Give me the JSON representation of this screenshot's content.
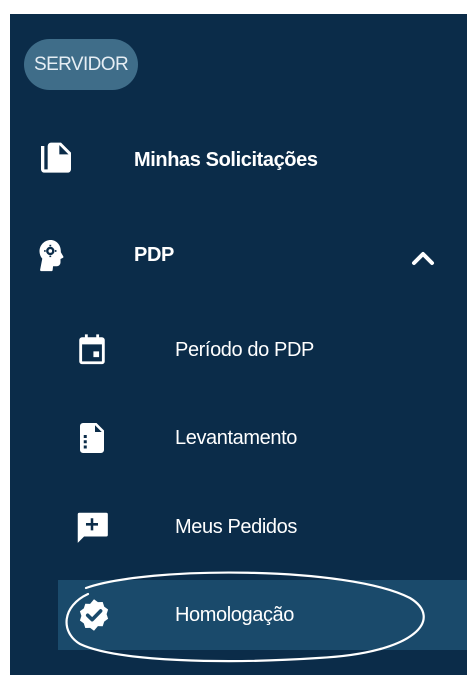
{
  "sidebar": {
    "role_badge": "SERVIDOR",
    "items": [
      {
        "label": "Minhas Solicitações",
        "icon": "file-copy-icon"
      },
      {
        "label": "PDP",
        "icon": "head-gear-icon",
        "expanded": true,
        "chevron_icon": "chevron-up-icon"
      }
    ],
    "subitems": [
      {
        "label": "Período do PDP",
        "icon": "calendar-icon"
      },
      {
        "label": "Levantamento",
        "icon": "document-list-icon"
      },
      {
        "label": "Meus Pedidos",
        "icon": "comment-add-icon"
      },
      {
        "label": "Homologação",
        "icon": "verified-badge-icon",
        "active": true
      }
    ]
  },
  "colors": {
    "sidebar_bg": "#0b2c49",
    "badge_bg": "#3f6d89",
    "active_bg": "#1a4a6b",
    "text": "#ffffff"
  }
}
